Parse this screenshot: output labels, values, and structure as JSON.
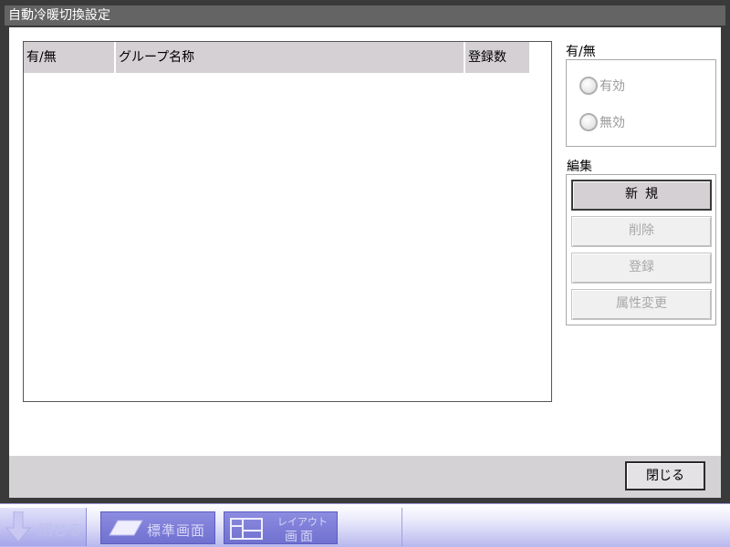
{
  "window": {
    "title": "自動冷暖切換設定"
  },
  "table": {
    "columns": [
      "有/無",
      "グループ名称",
      "登録数"
    ],
    "rows": []
  },
  "enable_group": {
    "label": "有/無",
    "options": [
      "有効",
      "無効"
    ]
  },
  "edit_group": {
    "label": "編集",
    "buttons": {
      "new": "新規",
      "delete": "削除",
      "register": "登録",
      "attribute_change": "属性変更"
    }
  },
  "footer": {
    "close": "閉じる"
  },
  "taskbar": {
    "close": "閉じる",
    "standard_screen": "標準画面",
    "layout_line1": "レイアウト",
    "layout_line2": "画面"
  },
  "colors": {
    "title_bg": "#646464",
    "taskbar_button": "#7c7cd8",
    "disabled_text": "#a8a8a8"
  }
}
